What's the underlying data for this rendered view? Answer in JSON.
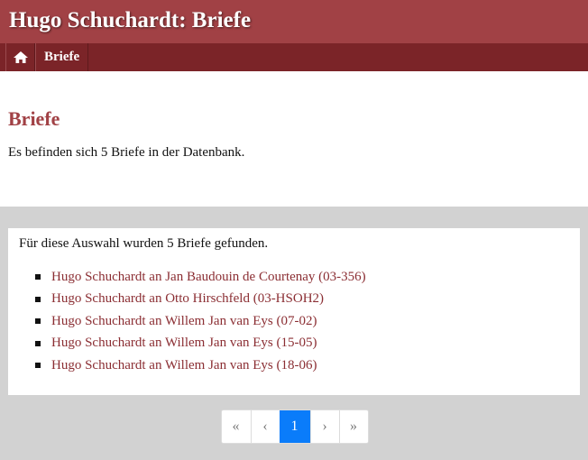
{
  "header": {
    "site_title": "Hugo Schuchardt: Briefe"
  },
  "navbar": {
    "home_icon": "home-icon",
    "item_label": "Briefe"
  },
  "main": {
    "page_title": "Briefe",
    "info_text": "Es befinden sich 5 Briefe in der Datenbank."
  },
  "results": {
    "count_text": "Für diese Auswahl wurden 5 Briefe gefunden.",
    "letters": [
      "Hugo Schuchardt an Jan Baudouin de Courtenay (03-356)",
      "Hugo Schuchardt an Otto Hirschfeld (03-HSOH2)",
      "Hugo Schuchardt an Willem Jan van Eys (07-02)",
      "Hugo Schuchardt an Willem Jan van Eys (15-05)",
      "Hugo Schuchardt an Willem Jan van Eys (18-06)"
    ]
  },
  "pagination": {
    "first": "«",
    "prev": "‹",
    "current": "1",
    "next": "›",
    "last": "»"
  },
  "colors": {
    "header_bg": "#a14145",
    "navbar_bg": "#7b2428",
    "title_color": "#a14145",
    "link_color": "#8b2e33",
    "results_bg": "#d2d2d2",
    "active_page": "#0a7cfa"
  }
}
